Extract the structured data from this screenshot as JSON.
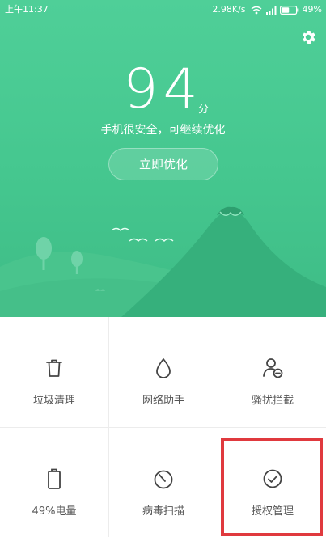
{
  "status_bar": {
    "time": "上午11:37",
    "net_speed": "2.98K/s",
    "battery": "49%"
  },
  "header": {
    "settings_icon": "gear-icon"
  },
  "score": {
    "value": "94",
    "unit": "分",
    "status": "手机很安全，可继续优化"
  },
  "optimize_button": {
    "label": "立即优化"
  },
  "tools": [
    {
      "label": "垃圾清理",
      "icon": "trash-icon"
    },
    {
      "label": "网络助手",
      "icon": "droplet-icon"
    },
    {
      "label": "骚扰拦截",
      "icon": "user-block-icon"
    },
    {
      "label": "49%电量",
      "icon": "battery-icon"
    },
    {
      "label": "病毒扫描",
      "icon": "scan-icon"
    },
    {
      "label": "授权管理",
      "icon": "check-circle-icon"
    }
  ],
  "colors": {
    "hero_green": "#4fcf98",
    "hill_green": "#3cb784",
    "highlight_red": "#e0393e"
  }
}
